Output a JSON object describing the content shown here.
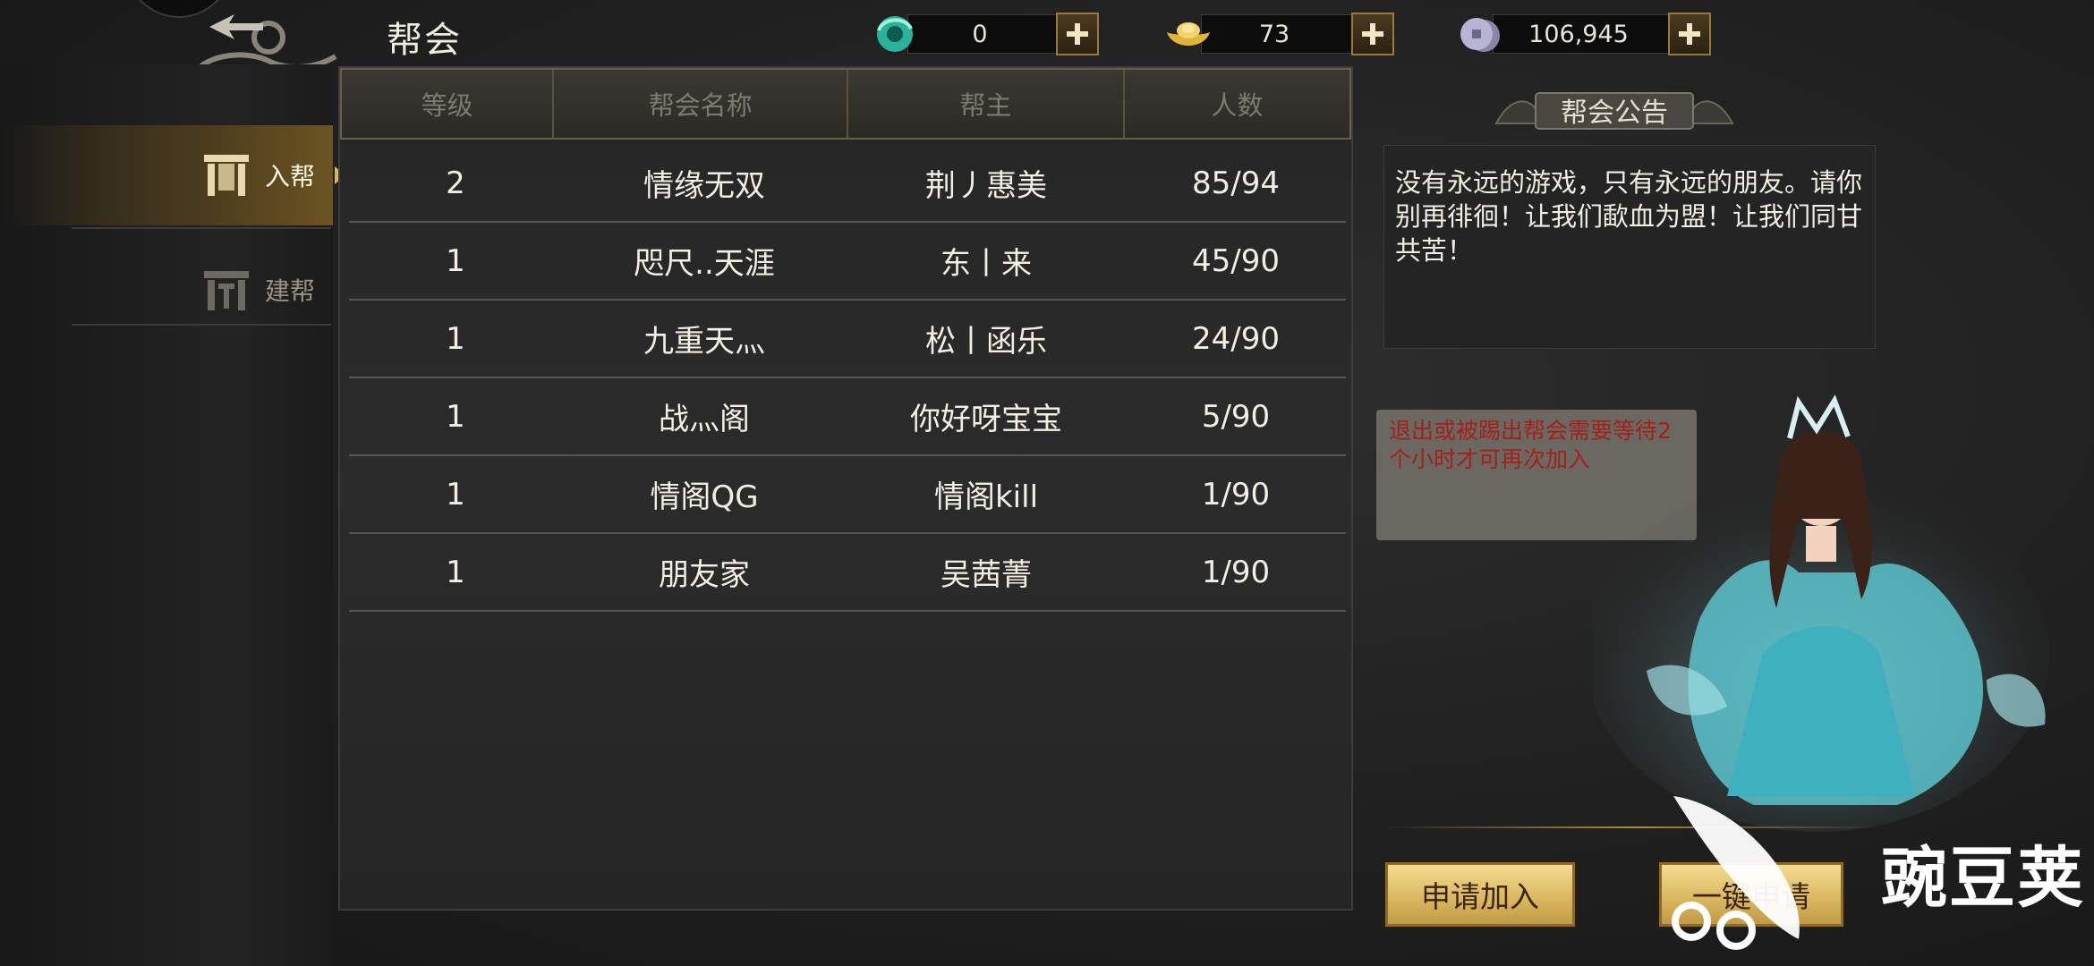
{
  "header": {
    "title": "帮会",
    "currencies": [
      {
        "icon": "jade-icon",
        "value": "0"
      },
      {
        "icon": "gold-ingot-icon",
        "value": "73"
      },
      {
        "icon": "silver-coin-icon",
        "value": "106,945"
      }
    ]
  },
  "sidebar": {
    "items": [
      {
        "label": "入帮",
        "active": true
      },
      {
        "label": "建帮",
        "active": false
      }
    ]
  },
  "guild_list": {
    "columns": [
      "等级",
      "帮会名称",
      "帮主",
      "人数"
    ],
    "rows": [
      {
        "level": "2",
        "name": "情缘无双",
        "leader": "荆丿惠美",
        "members": "85/94"
      },
      {
        "level": "1",
        "name": "咫尺..天涯",
        "leader": "东丨来",
        "members": "45/90"
      },
      {
        "level": "1",
        "name": "九重天灬",
        "leader": "松丨函乐",
        "members": "24/90"
      },
      {
        "level": "1",
        "name": "战灬阁",
        "leader": "你好呀宝宝",
        "members": "5/90"
      },
      {
        "level": "1",
        "name": "情阁QG",
        "leader": "情阁kill",
        "members": "1/90"
      },
      {
        "level": "1",
        "name": "朋友家",
        "leader": "吴茜菁",
        "members": "1/90"
      }
    ]
  },
  "notice": {
    "title": "帮会公告",
    "text": "没有永远的游戏，只有永远的朋友。请你别再徘徊！让我们歃血为盟！让我们同甘共苦！"
  },
  "tip": {
    "text": "退出或被踢出帮会需要等待2个小时才可再次加入"
  },
  "buttons": {
    "apply": "申请加入",
    "quick_apply": "一键申请"
  },
  "watermark": {
    "text": "豌豆荚"
  },
  "colors": {
    "gold_button": "#d9b55e",
    "tip_text": "#a3211a",
    "background": "#222222"
  }
}
